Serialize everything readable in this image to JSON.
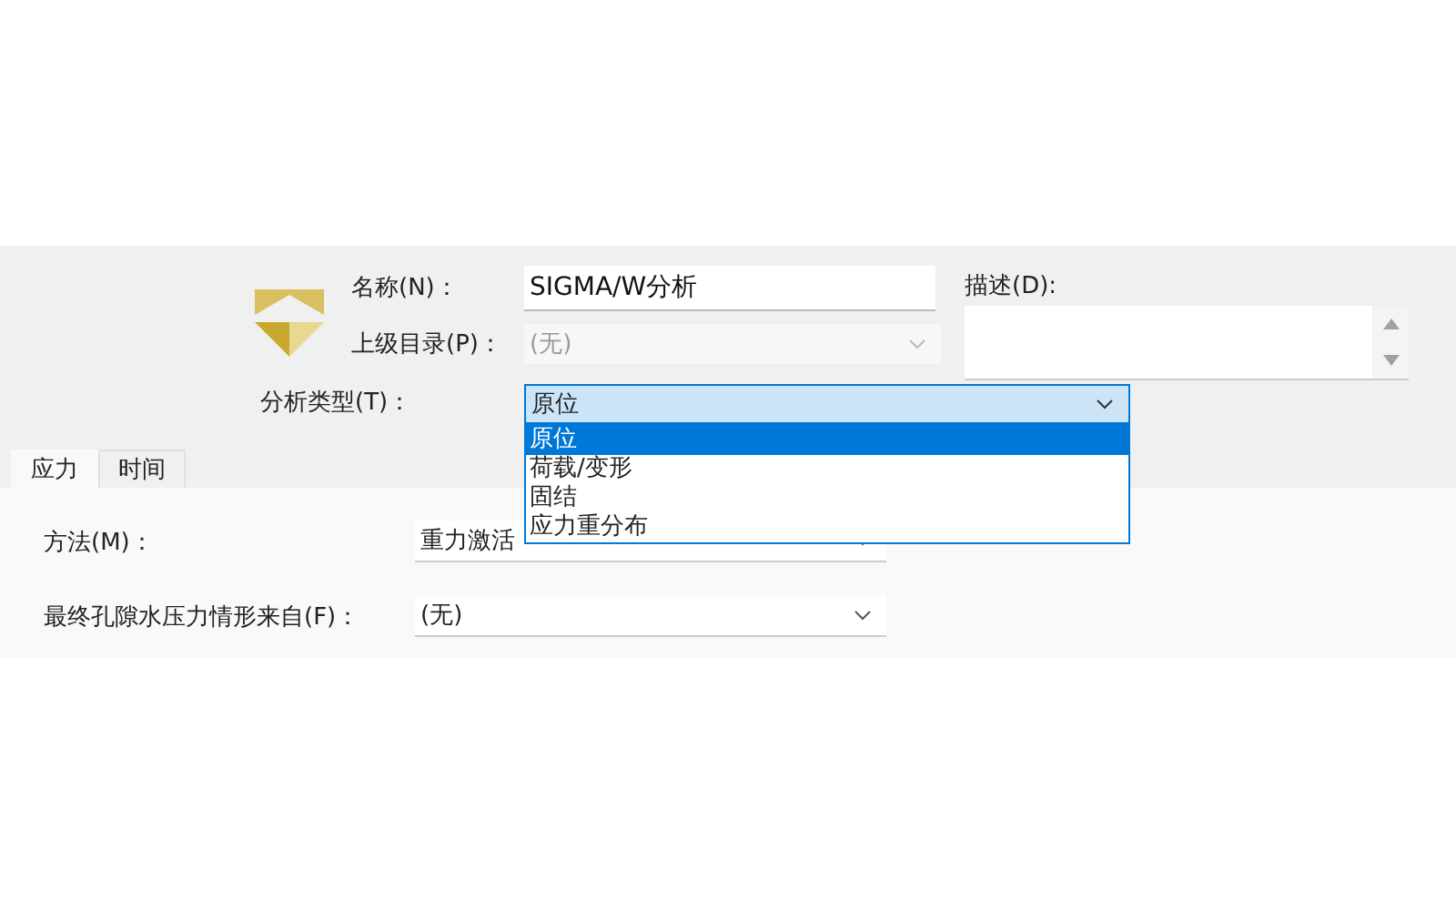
{
  "header": {
    "name_label": "名称(N)：",
    "name_value": "SIGMA/W分析",
    "parent_label": "上级目录(P)：",
    "parent_value": "(无)",
    "parent_disabled": true,
    "description_label": "描述(D):",
    "type_label": "分析类型(T)：",
    "type_value": "原位",
    "type_expanded": true,
    "type_options": [
      {
        "label": "原位",
        "selected": true
      },
      {
        "label": "荷载/变形",
        "selected": false
      },
      {
        "label": "固结",
        "selected": false
      },
      {
        "label": "应力重分布",
        "selected": false
      }
    ]
  },
  "tabs": [
    {
      "label": "应力",
      "selected": true
    },
    {
      "label": "时间",
      "selected": false
    }
  ],
  "fields": [
    {
      "label": "方法(M)：",
      "value": "重力激活"
    },
    {
      "label": "最终孔隙水压力情形来自(F)：",
      "value": "(无)"
    }
  ]
}
